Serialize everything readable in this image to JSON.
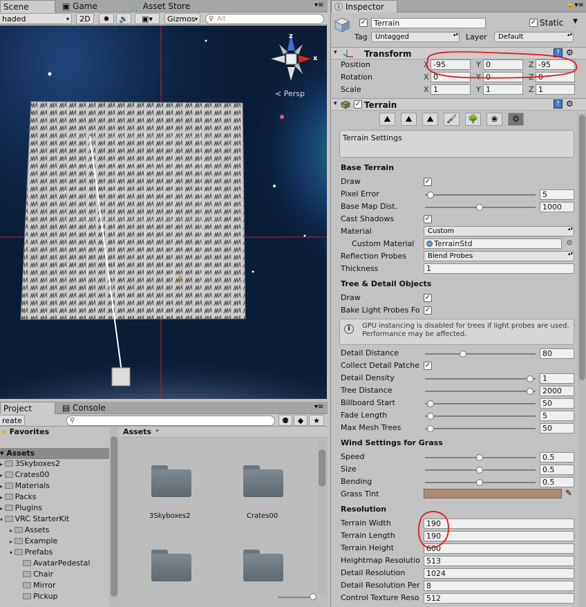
{
  "scene_panel": {
    "tabs": [
      "Scene",
      "Game",
      "Asset Store"
    ],
    "shading_mode": "haded",
    "mode_2d": "2D",
    "gizmos_label": "Gizmos",
    "search_placeholder": "All",
    "persp_label": "< Persp",
    "axis_labels": {
      "z": "z",
      "x": "x"
    }
  },
  "project_panel": {
    "tabs": [
      "Project",
      "Console"
    ],
    "create_label": "reate",
    "favorites_label": "Favorites",
    "assets_label": "Assets",
    "breadcrumb": "Assets",
    "tree": [
      {
        "label": "3Skyboxes2",
        "indent": 1
      },
      {
        "label": "Crates00",
        "indent": 1
      },
      {
        "label": "Materials",
        "indent": 1
      },
      {
        "label": "Packs",
        "indent": 1
      },
      {
        "label": "Plugins",
        "indent": 1
      },
      {
        "label": "VRC StarterKit",
        "indent": 1
      },
      {
        "label": "Assets",
        "indent": 2
      },
      {
        "label": "Example",
        "indent": 2
      },
      {
        "label": "Prefabs",
        "indent": 2
      },
      {
        "label": "AvatarPedestal",
        "indent": 3
      },
      {
        "label": "Chair",
        "indent": 3
      },
      {
        "label": "Mirror",
        "indent": 3
      },
      {
        "label": "Pickup",
        "indent": 3
      }
    ],
    "grid_items": [
      "3Skyboxes2",
      "Crates00",
      "",
      ""
    ]
  },
  "inspector": {
    "tab_label": "Inspector",
    "object_name": "Terrain",
    "static_label": "Static",
    "tag_label": "Tag",
    "tag_value": "Untagged",
    "layer_label": "Layer",
    "layer_value": "Default",
    "transform": {
      "title": "Transform",
      "rows": [
        {
          "label": "Position",
          "x": "-95",
          "y": "0",
          "z": "-95"
        },
        {
          "label": "Rotation",
          "x": "0",
          "y": "0",
          "z": "0"
        },
        {
          "label": "Scale",
          "x": "1",
          "y": "1",
          "z": "1"
        }
      ],
      "axis": [
        "X",
        "Y",
        "Z"
      ]
    },
    "terrain": {
      "title": "Terrain",
      "settings_box": "Terrain Settings",
      "base_terrain_header": "Base Terrain",
      "draw_label": "Draw",
      "pixel_error": {
        "label": "Pixel Error",
        "value": "5",
        "pos": 0.02
      },
      "base_map_dist": {
        "label": "Base Map Dist.",
        "value": "1000",
        "pos": 0.49
      },
      "cast_shadows_label": "Cast Shadows",
      "material": {
        "label": "Material",
        "value": "Custom"
      },
      "custom_material": {
        "label": "Custom Material",
        "value": "TerrainStd"
      },
      "reflection_probes": {
        "label": "Reflection Probes",
        "value": "Blend Probes"
      },
      "thickness": {
        "label": "Thickness",
        "value": "1"
      },
      "tree_header": "Tree & Detail Objects",
      "tree_draw_label": "Draw",
      "bake_light_label": "Bake Light Probes Fo",
      "gpu_note": "GPU instancing is disabled for trees if light probes are used. Performance may be affected.",
      "sliders": [
        {
          "label": "Detail Distance",
          "value": "80",
          "pos": 0.33
        },
        {
          "label": "Collect Detail Patche",
          "value": "",
          "pos": -1
        },
        {
          "label": "Detail Density",
          "value": "1",
          "pos": 0.98
        },
        {
          "label": "Tree Distance",
          "value": "2000",
          "pos": 0.98
        },
        {
          "label": "Billboard Start",
          "value": "50",
          "pos": 0.02
        },
        {
          "label": "Fade Length",
          "value": "5",
          "pos": 0.02
        },
        {
          "label": "Max Mesh Trees",
          "value": "50",
          "pos": 0.02
        }
      ],
      "wind_header": "Wind Settings for Grass",
      "wind": [
        {
          "label": "Speed",
          "value": "0.5",
          "pos": 0.49
        },
        {
          "label": "Size",
          "value": "0.5",
          "pos": 0.49
        },
        {
          "label": "Bending",
          "value": "0.5",
          "pos": 0.49
        }
      ],
      "grass_tint_label": "Grass Tint",
      "grass_tint_color": "#b08a6e",
      "resolution_header": "Resolution",
      "resolution": [
        {
          "label": "Terrain Width",
          "value": "190"
        },
        {
          "label": "Terrain Length",
          "value": "190"
        },
        {
          "label": "Terrain Height",
          "value": "600"
        },
        {
          "label": "Heightmap Resolutio",
          "value": "513"
        },
        {
          "label": "Detail Resolution",
          "value": "1024"
        },
        {
          "label": "Detail Resolution Per",
          "value": "8"
        },
        {
          "label": "Control Texture Reso",
          "value": "512"
        }
      ]
    }
  },
  "colors": {
    "annotation_red": "#e8161b",
    "panel_bg": "#c2c2c2",
    "accent_blue": "#3c78d8"
  }
}
